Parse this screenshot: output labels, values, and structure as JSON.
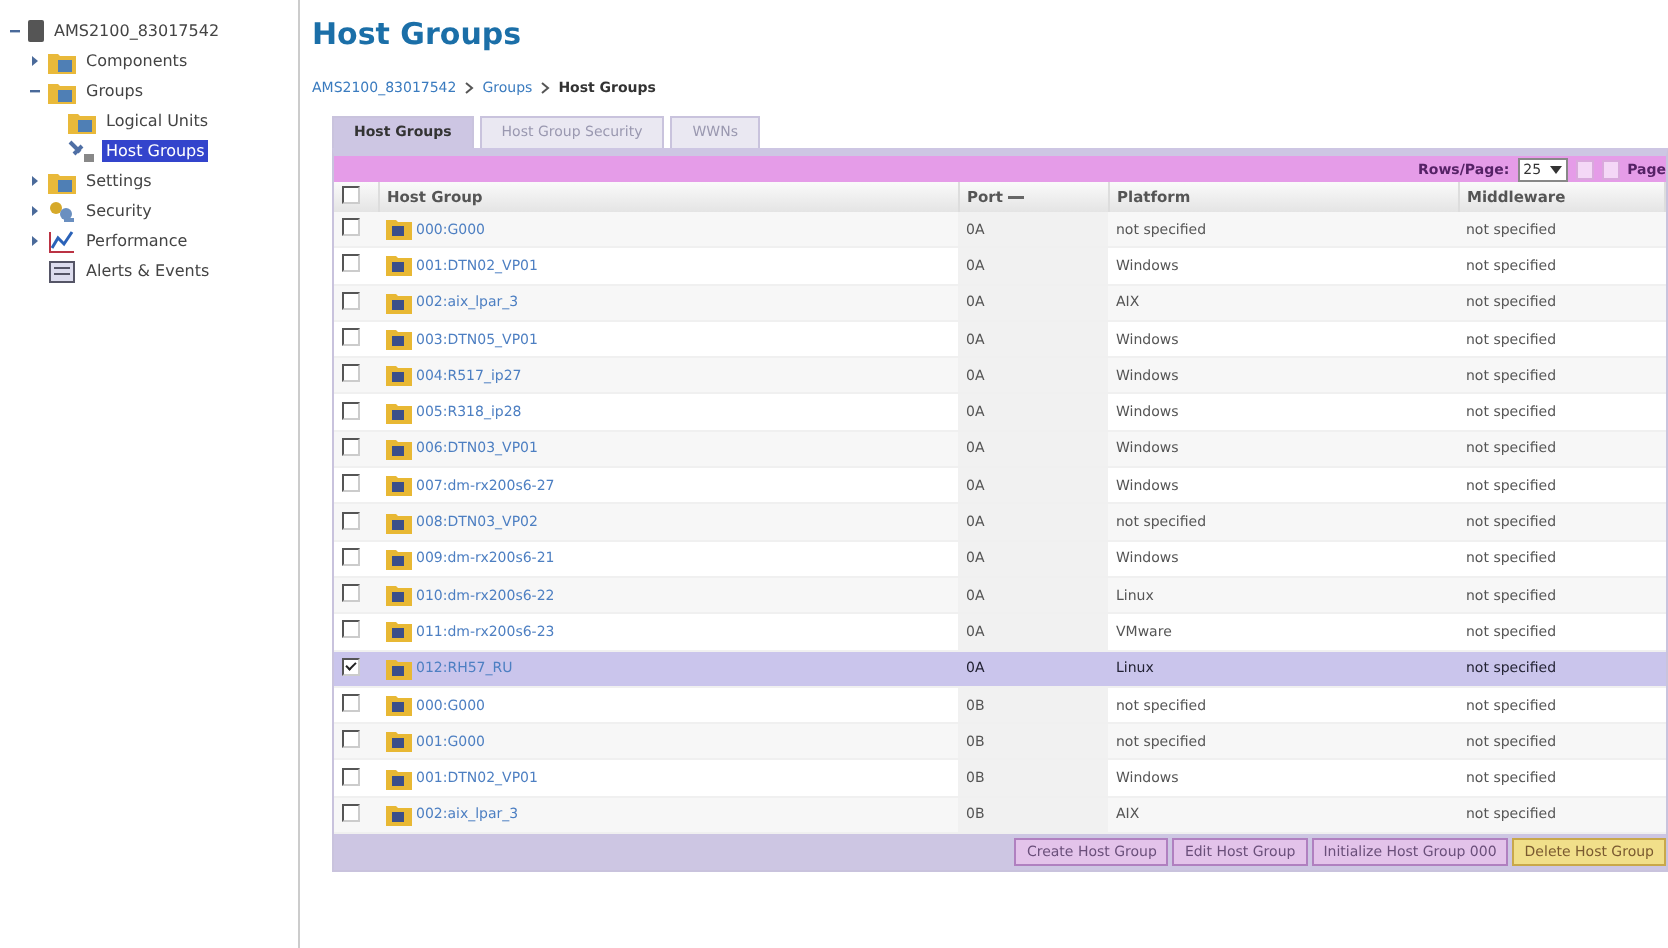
{
  "tree": {
    "label": "AMS2100_83017542",
    "expanded": true,
    "children": [
      {
        "label": "Components",
        "kind": "folder",
        "expanded": false,
        "selected": false
      },
      {
        "label": "Groups",
        "kind": "folder",
        "expanded": true,
        "selected": false,
        "children": [
          {
            "label": "Logical Units",
            "kind": "folder",
            "selected": false
          },
          {
            "label": "Host Groups",
            "kind": "host",
            "selected": true
          }
        ]
      },
      {
        "label": "Settings",
        "kind": "folder",
        "expanded": false,
        "selected": false
      },
      {
        "label": "Security",
        "kind": "keys",
        "expanded": false,
        "selected": false
      },
      {
        "label": "Performance",
        "kind": "chart",
        "expanded": false,
        "selected": false
      },
      {
        "label": "Alerts & Events",
        "kind": "alerts",
        "selected": false
      }
    ]
  },
  "title": "Host Groups",
  "breadcrumb": [
    {
      "label": "AMS2100_83017542",
      "link": true
    },
    {
      "label": "Groups",
      "link": true
    },
    {
      "label": "Host Groups",
      "link": false
    }
  ],
  "tabs": [
    {
      "label": "Host Groups",
      "selected": true
    },
    {
      "label": "Host Group Security",
      "selected": false
    },
    {
      "label": "WWNs",
      "selected": false
    }
  ],
  "pager": {
    "label": "Rows/Page:",
    "rows_per_page": "25",
    "page_label": "Page"
  },
  "table": {
    "columns": [
      {
        "label": "Host Group",
        "sorted": false
      },
      {
        "label": "Port",
        "sorted": true
      },
      {
        "label": "Platform",
        "sorted": false
      },
      {
        "label": "Middleware",
        "sorted": false
      }
    ],
    "all_checked": false,
    "rows": [
      {
        "host_group": "000:G000",
        "port": "0A",
        "platform": "not specified",
        "middleware": "not specified",
        "selected": false
      },
      {
        "host_group": "001:DTN02_VP01",
        "port": "0A",
        "platform": "Windows",
        "middleware": "not specified",
        "selected": false
      },
      {
        "host_group": "002:aix_lpar_3",
        "port": "0A",
        "platform": "AIX",
        "middleware": "not specified",
        "selected": false
      },
      {
        "host_group": "003:DTN05_VP01",
        "port": "0A",
        "platform": "Windows",
        "middleware": "not specified",
        "selected": false
      },
      {
        "host_group": "004:R517_ip27",
        "port": "0A",
        "platform": "Windows",
        "middleware": "not specified",
        "selected": false
      },
      {
        "host_group": "005:R318_ip28",
        "port": "0A",
        "platform": "Windows",
        "middleware": "not specified",
        "selected": false
      },
      {
        "host_group": "006:DTN03_VP01",
        "port": "0A",
        "platform": "Windows",
        "middleware": "not specified",
        "selected": false
      },
      {
        "host_group": "007:dm-rx200s6-27",
        "port": "0A",
        "platform": "Windows",
        "middleware": "not specified",
        "selected": false
      },
      {
        "host_group": "008:DTN03_VP02",
        "port": "0A",
        "platform": "not specified",
        "middleware": "not specified",
        "selected": false
      },
      {
        "host_group": "009:dm-rx200s6-21",
        "port": "0A",
        "platform": "Windows",
        "middleware": "not specified",
        "selected": false
      },
      {
        "host_group": "010:dm-rx200s6-22",
        "port": "0A",
        "platform": "Linux",
        "middleware": "not specified",
        "selected": false
      },
      {
        "host_group": "011:dm-rx200s6-23",
        "port": "0A",
        "platform": "VMware",
        "middleware": "not specified",
        "selected": false
      },
      {
        "host_group": "012:RH57_RU",
        "port": "0A",
        "platform": "Linux",
        "middleware": "not specified",
        "selected": true
      },
      {
        "host_group": "000:G000",
        "port": "0B",
        "platform": "not specified",
        "middleware": "not specified",
        "selected": false
      },
      {
        "host_group": "001:G000",
        "port": "0B",
        "platform": "not specified",
        "middleware": "not specified",
        "selected": false
      },
      {
        "host_group": "001:DTN02_VP01",
        "port": "0B",
        "platform": "Windows",
        "middleware": "not specified",
        "selected": false
      },
      {
        "host_group": "002:aix_lpar_3",
        "port": "0B",
        "platform": "AIX",
        "middleware": "not specified",
        "selected": false
      }
    ]
  },
  "buttons": [
    {
      "label": "Create Host Group",
      "highlighted": false
    },
    {
      "label": "Edit Host Group",
      "highlighted": false
    },
    {
      "label": "Initialize Host Group 000",
      "highlighted": false
    },
    {
      "label": "Delete Host Group",
      "highlighted": true
    }
  ]
}
